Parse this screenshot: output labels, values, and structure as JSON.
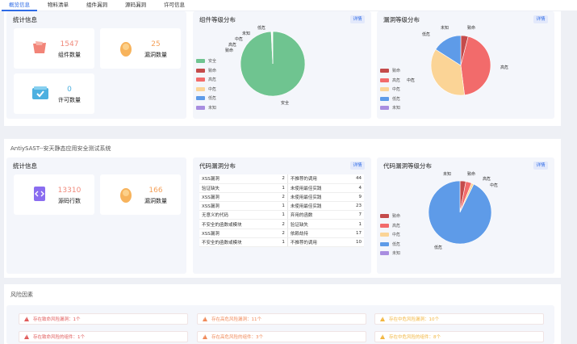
{
  "tabs": [
    "概览信息",
    "物料清单",
    "组件漏洞",
    "源码漏洞",
    "许可信息"
  ],
  "section1": {
    "stats_title": "统计信息",
    "stats": [
      {
        "value": "1547",
        "label": "组件数量",
        "color": "#f08a7c",
        "icon": "component-icon"
      },
      {
        "value": "25",
        "label": "漏洞数量",
        "color": "#f5a25b",
        "icon": "vuln-icon"
      },
      {
        "value": "0",
        "label": "许可数量",
        "color": "#4db0e0",
        "icon": "license-icon"
      }
    ],
    "component_chart_title": "组件等级分布",
    "vuln_chart_title": "漏洞等级分布",
    "detail_label": "详情"
  },
  "legend_component": [
    "安全",
    "致命",
    "高危",
    "中危",
    "低危",
    "未知"
  ],
  "legend_level": [
    "致命",
    "高危",
    "中危",
    "低危",
    "未知"
  ],
  "colors": {
    "safe": "#6fc490",
    "fatal": "#c44b4b",
    "high": "#f26b6b",
    "medium": "#fbd496",
    "low": "#5e9be8",
    "unknown": "#a88de0",
    "accent": "#2e6be6"
  },
  "chart_data": [
    {
      "type": "pie",
      "title": "组件等级分布",
      "labels": [
        "安全",
        "致命",
        "高危",
        "中危",
        "低危",
        "未知"
      ],
      "values": [
        1522,
        0,
        3,
        3,
        3,
        3
      ]
    },
    {
      "type": "pie",
      "title": "漏洞等级分布",
      "labels": [
        "致命",
        "高危",
        "中危",
        "低危",
        "未知"
      ],
      "values": [
        1,
        11,
        9,
        4,
        0
      ]
    },
    {
      "type": "pie",
      "title": "代码漏洞等级分布",
      "labels": [
        "致命",
        "高危",
        "中危",
        "低危",
        "未知"
      ],
      "values": [
        5,
        5,
        2,
        154,
        0
      ]
    }
  ],
  "section2": {
    "system_title": "AntiySAST--安天静态应用安全测试系统",
    "stats_title": "统计信息",
    "stats": [
      {
        "value": "13310",
        "label": "源码行数",
        "color": "#f08a7c",
        "icon": "code-icon"
      },
      {
        "value": "166",
        "label": "漏洞数量",
        "color": "#f5a25b",
        "icon": "vuln-icon"
      }
    ],
    "code_vuln_title": "代码漏洞分布",
    "code_level_title": "代码漏洞等级分布",
    "detail_label": "详情",
    "table": [
      [
        "XSS漏洞",
        "2",
        "不推荐的调用",
        "44"
      ],
      [
        "验证缺失",
        "1",
        "未使用最佳实践",
        "4"
      ],
      [
        "XSS漏洞",
        "2",
        "未使用最佳实践",
        "9"
      ],
      [
        "XSS漏洞",
        "1",
        "未使用最佳实践",
        "23"
      ],
      [
        "无意义的代码",
        "1",
        "弃用的函数",
        "7"
      ],
      [
        "不安全的函数或模块",
        "2",
        "验证缺失",
        "1"
      ],
      [
        "XSS漏洞",
        "2",
        "依赖劫持",
        "17"
      ],
      [
        "不安全的函数或模块",
        "1",
        "不推荐的调用",
        "10"
      ]
    ]
  },
  "risk": {
    "title": "风险因素",
    "items": [
      {
        "text": "存在致命风险漏洞：1个",
        "color": "#e05a5a"
      },
      {
        "text": "存在高危风险漏洞：11个",
        "color": "#f08a5a"
      },
      {
        "text": "存在中危风险漏洞：10个",
        "color": "#f2b640"
      },
      {
        "text": "存在致命风险的组件：1个",
        "color": "#e05a5a"
      },
      {
        "text": "存在高危风险的组件：3个",
        "color": "#f08a5a"
      },
      {
        "text": "存在中危风险的组件：8个",
        "color": "#f2b640"
      }
    ]
  }
}
